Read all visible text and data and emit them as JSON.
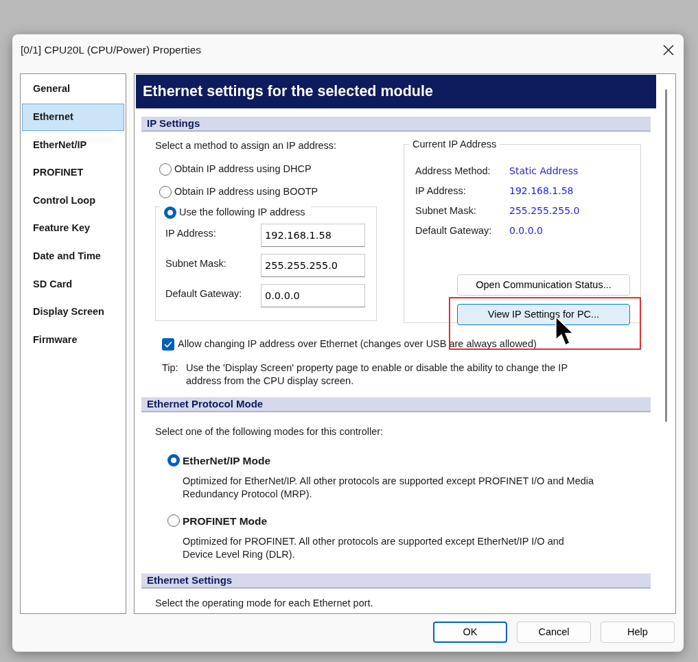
{
  "window": {
    "title": "[0/1] CPU20L (CPU/Power) Properties"
  },
  "sidebar": {
    "items": [
      {
        "label": "General",
        "selected": false
      },
      {
        "label": "Ethernet",
        "selected": true
      },
      {
        "label": "EtherNet/IP",
        "selected": false
      },
      {
        "label": "PROFINET",
        "selected": false
      },
      {
        "label": "Control Loop",
        "selected": false
      },
      {
        "label": "Feature Key",
        "selected": false
      },
      {
        "label": "Date and Time",
        "selected": false
      },
      {
        "label": "SD Card",
        "selected": false
      },
      {
        "label": "Display Screen",
        "selected": false
      },
      {
        "label": "Firmware",
        "selected": false
      }
    ]
  },
  "page": {
    "title": "Ethernet settings for the selected module"
  },
  "ip_settings": {
    "heading": "IP Settings",
    "prompt": "Select a method to assign an IP address:",
    "methods": [
      {
        "label": "Obtain IP address using DHCP",
        "selected": false
      },
      {
        "label": "Obtain IP address using BOOTP",
        "selected": false
      },
      {
        "label": "Use the following IP address",
        "selected": true
      }
    ],
    "fields": [
      {
        "label": "IP Address:",
        "value": "192.168.1.58"
      },
      {
        "label": "Subnet Mask:",
        "value": "255.255.255.0"
      },
      {
        "label": "Default Gateway:",
        "value": "0.0.0.0"
      }
    ],
    "current": {
      "title": "Current IP Address",
      "rows": [
        {
          "label": "Address Method:",
          "value": "Static Address"
        },
        {
          "label": "IP Address:",
          "value": "192.168.1.58"
        },
        {
          "label": "Subnet Mask:",
          "value": "255.255.255.0"
        },
        {
          "label": "Default Gateway:",
          "value": "0.0.0.0"
        }
      ]
    },
    "buttons": [
      {
        "label": "Open Communication Status...",
        "hovered": false,
        "annotated": false
      },
      {
        "label": "View IP Settings for PC...",
        "hovered": true,
        "annotated": true
      }
    ],
    "allow_change": {
      "label": "Allow changing IP address over Ethernet (changes over USB are always allowed)",
      "checked": true
    },
    "tip": {
      "label": "Tip:",
      "text": "Use the 'Display Screen' property page to enable or disable the ability to change the IP address from the CPU display screen."
    }
  },
  "protocol": {
    "heading": "Ethernet Protocol Mode",
    "prompt": "Select one of the following modes for this controller:",
    "modes": [
      {
        "label": "EtherNet/IP Mode",
        "description": "Optimized for EtherNet/IP. All other protocols are supported except PROFINET I/O and Media Redundancy Protocol (MRP).",
        "selected": true
      },
      {
        "label": "PROFINET Mode",
        "description": "Optimized for PROFINET. All other protocols are supported except EtherNet/IP I/O and Device Level Ring (DLR).",
        "selected": false
      }
    ]
  },
  "ethernet_settings": {
    "heading": "Ethernet Settings",
    "prompt": "Select the operating mode for each Ethernet port."
  },
  "buttons": [
    {
      "label": "OK",
      "default": true
    },
    {
      "label": "Cancel",
      "default": false
    },
    {
      "label": "Help",
      "default": false
    }
  ]
}
